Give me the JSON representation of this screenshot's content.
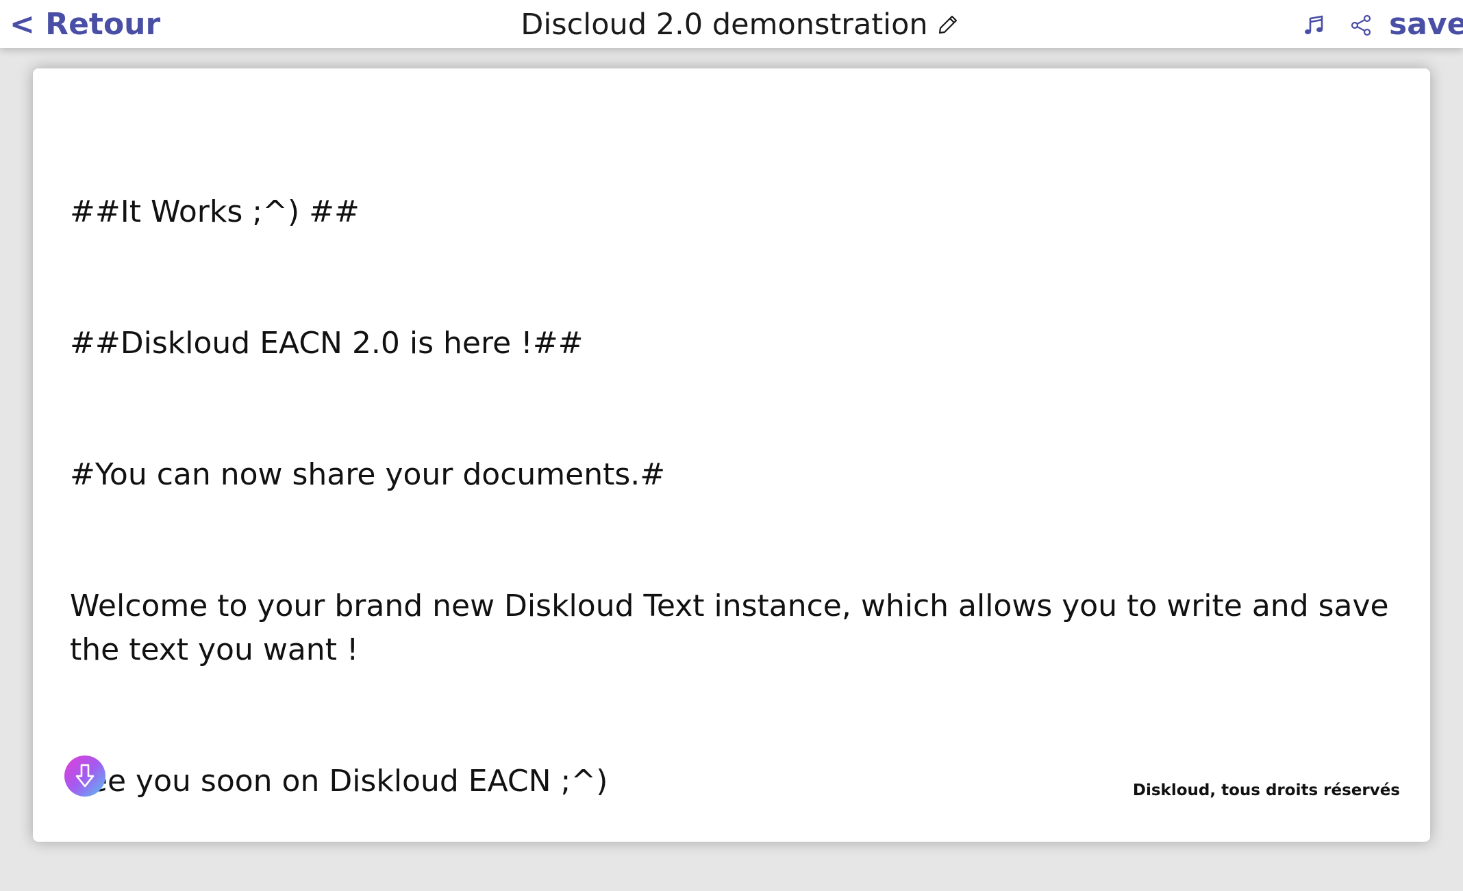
{
  "header": {
    "back_label": "< Retour",
    "title": "Discloud 2.0 demonstration",
    "save_label": "save",
    "edit_icon": "pencil-icon",
    "music_icon": "music-note-icon",
    "share_icon": "share-icon",
    "accent_color": "#4a4fa6"
  },
  "editor": {
    "lines": [
      "##It Works ;^) ##",
      "##Diskloud EACN 2.0 is here !##",
      "#You can now share your documents.#",
      "Welcome to your brand new Diskloud Text instance, which allows you to write and save the text you want !",
      "See you soon on Diskloud EACN ;^)"
    ]
  },
  "footer": {
    "download_icon": "download-arrow-icon",
    "copyright": "Diskloud, tous droits réservés"
  }
}
